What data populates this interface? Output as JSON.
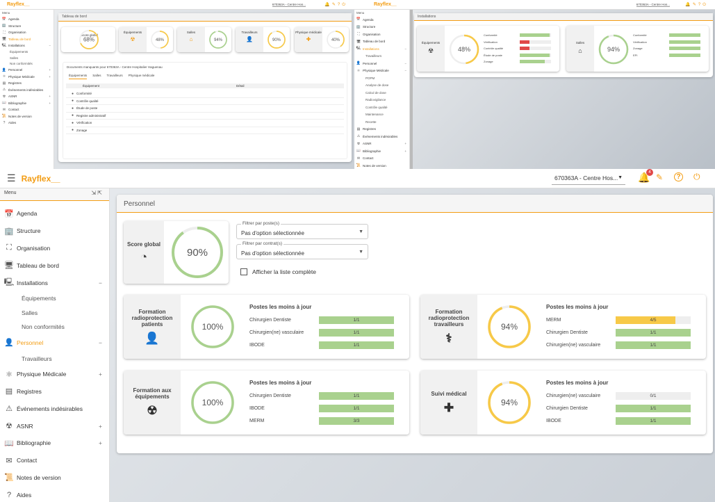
{
  "app": {
    "name": "Rayflex__",
    "site": "670363A - Centre Hos...",
    "site_small": "670363A - Centre Hos...",
    "notif_count": "4",
    "menu_label": "Menu"
  },
  "colors": {
    "accent": "#f39c12",
    "green": "#a9d18e",
    "yellow": "#f7c948",
    "red": "#e04848"
  },
  "sidebar": {
    "items": [
      "Agenda",
      "Structure",
      "Organisation",
      "Tableau de bord",
      "Installations",
      "Personnel",
      "Physique Médicale",
      "Registres",
      "Événements indésirables",
      "ASNR",
      "Bibliographie",
      "Contact",
      "Notes de version",
      "Aides"
    ],
    "installations_sub": [
      "Équipements",
      "Salles",
      "Non conformités"
    ],
    "personnel_sub": [
      "Travailleurs"
    ],
    "physique_sub": [
      "POPM",
      "Analyse de dose",
      "Calcul de dose",
      "Radiovigilance",
      "Contrôle qualité",
      "Maintenance",
      "Recette"
    ]
  },
  "dashboard": {
    "title": "Tableau de bord",
    "tiles": [
      {
        "label": "Score global",
        "value": "68%",
        "pct": 68
      },
      {
        "label": "Équipements",
        "value": "48%",
        "pct": 48
      },
      {
        "label": "Salles",
        "value": "94%",
        "pct": 94
      },
      {
        "label": "Travailleurs",
        "value": "90%",
        "pct": 90
      },
      {
        "label": "Physique médicale",
        "value": "40%",
        "pct": 40
      }
    ],
    "docs_title": "Documents manquants pour 670363A - Centre Hospitalier Haguenau",
    "tabs": [
      "Équipements",
      "Salles",
      "Travailleurs",
      "Physique médicale"
    ],
    "table_headers": [
      "Équipement",
      "Détail"
    ],
    "rows": [
      "Conformité",
      "Contrôle qualité",
      "Étude de poste",
      "Registre administratif",
      "Vérification",
      "Zonage"
    ]
  },
  "installations": {
    "title": "Installations",
    "equip": {
      "label": "Équipements",
      "value": "48%",
      "pct": 48,
      "rows": [
        {
          "name": "Conformité",
          "pct": 95,
          "color": "#a9d18e"
        },
        {
          "name": "Vérification",
          "pct": 30,
          "color": "#e04848"
        },
        {
          "name": "Contrôle qualité",
          "pct": 30,
          "color": "#e04848"
        },
        {
          "name": "Étude de poste",
          "pct": 95,
          "color": "#a9d18e"
        },
        {
          "name": "Zonage",
          "pct": 80,
          "color": "#a9d18e"
        }
      ]
    },
    "salles": {
      "label": "Salles",
      "value": "94%",
      "pct": 94,
      "rows": [
        {
          "name": "Conformité",
          "pct": 100
        },
        {
          "name": "Vérification",
          "pct": 100
        },
        {
          "name": "Zonage",
          "pct": 100
        },
        {
          "name": "EPI",
          "pct": 100
        }
      ]
    }
  },
  "personnel": {
    "title": "Personnel",
    "score": {
      "label": "Score global",
      "value": "90%",
      "pct": 90
    },
    "filter_poste": {
      "caption": "Filtrer par poste(s)",
      "value": "Pas d'option sélectionnée"
    },
    "filter_contrat": {
      "caption": "Filtrer par contrat(s)",
      "value": "Pas d'option sélectionnée"
    },
    "checkbox_label": "Afficher la liste complète",
    "cards_title": "Postes les moins à jour",
    "cards": [
      {
        "label": "Formation radioprotection patients",
        "value": "100%",
        "pct": 100,
        "ring": "#a9d18e",
        "icon": "person-icon",
        "rows": [
          {
            "name": "Chirurgien Dentiste",
            "val": "1/1",
            "pct": 100,
            "color": "#a9d18e"
          },
          {
            "name": "Chirurgien(ne) vasculaire",
            "val": "1/1",
            "pct": 100,
            "color": "#a9d18e"
          },
          {
            "name": "IBODE",
            "val": "1/1",
            "pct": 100,
            "color": "#a9d18e"
          }
        ]
      },
      {
        "label": "Formation radioprotection travailleurs",
        "value": "94%",
        "pct": 94,
        "ring": "#f7c948",
        "icon": "doctor-icon",
        "rows": [
          {
            "name": "MERM",
            "val": "4/5",
            "pct": 80,
            "color": "#f7c948"
          },
          {
            "name": "Chirurgien Dentiste",
            "val": "1/1",
            "pct": 100,
            "color": "#a9d18e"
          },
          {
            "name": "Chirurgien(ne) vasculaire",
            "val": "1/1",
            "pct": 100,
            "color": "#a9d18e"
          }
        ]
      },
      {
        "label": "Formation aux équipements",
        "value": "100%",
        "pct": 100,
        "ring": "#a9d18e",
        "icon": "radiation-icon",
        "rows": [
          {
            "name": "Chirurgien Dentiste",
            "val": "1/1",
            "pct": 100,
            "color": "#a9d18e"
          },
          {
            "name": "IBODE",
            "val": "1/1",
            "pct": 100,
            "color": "#a9d18e"
          },
          {
            "name": "MERM",
            "val": "3/3",
            "pct": 100,
            "color": "#a9d18e"
          }
        ]
      },
      {
        "label": "Suivi médical",
        "value": "94%",
        "pct": 94,
        "ring": "#f7c948",
        "icon": "medkit-icon",
        "rows": [
          {
            "name": "Chirurgien(ne) vasculaire",
            "val": "0/1",
            "pct": 0,
            "color": "#a9d18e"
          },
          {
            "name": "Chirurgien Dentiste",
            "val": "1/1",
            "pct": 100,
            "color": "#a9d18e"
          },
          {
            "name": "IBODE",
            "val": "1/1",
            "pct": 100,
            "color": "#a9d18e"
          }
        ]
      }
    ]
  }
}
